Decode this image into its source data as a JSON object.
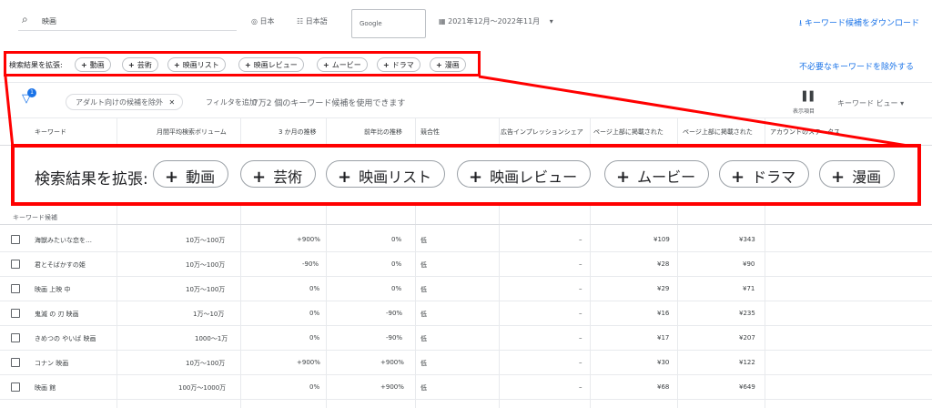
{
  "toolbar": {
    "search_text": "映画",
    "location": "日本",
    "language": "日本語",
    "engine": "Google",
    "date_range": "2021年12月～2022年11月",
    "download": "キーワード候補をダウンロード"
  },
  "refine": {
    "label": "検索結果を拡張:",
    "chips": [
      "動画",
      "芸術",
      "映画リスト",
      "映画レビュー",
      "ムービー",
      "ドラマ",
      "漫画"
    ],
    "exclude": "不必要なキーワードを除外する"
  },
  "filters": {
    "badge": "1",
    "adult_chip": "アダルト向けの候補を除外",
    "add_filter": "フィルタを追加",
    "count_text": "7万2 個のキーワード候補を使用できます",
    "columns_label": "表示項目",
    "keyword_view": "キーワード ビュー"
  },
  "table": {
    "headers": [
      "キーワード",
      "月間平均検索ボリューム",
      "3 か月の推移",
      "前年比の推移",
      "競合性",
      "広告インプレッションシェア",
      "ページ上部に掲載された",
      "ページ上部に掲載された",
      "アカウントのステータス"
    ],
    "section": "キーワード候補",
    "rows": [
      {
        "kw": "海獣みたいな恋を…",
        "vol": "10万～100万",
        "m3": "+900%",
        "yoy": "0%",
        "comp": "低",
        "share": "–",
        "low": "¥109",
        "high": "¥343"
      },
      {
        "kw": "君とそばかすの姫",
        "vol": "10万～100万",
        "m3": "-90%",
        "yoy": "0%",
        "comp": "低",
        "share": "–",
        "low": "¥28",
        "high": "¥90"
      },
      {
        "kw": "映画 上映 中",
        "vol": "10万～100万",
        "m3": "0%",
        "yoy": "0%",
        "comp": "低",
        "share": "–",
        "low": "¥29",
        "high": "¥71"
      },
      {
        "kw": "鬼滅 の 刃 映画",
        "vol": "1万～10万",
        "m3": "0%",
        "yoy": "-90%",
        "comp": "低",
        "share": "–",
        "low": "¥16",
        "high": "¥235"
      },
      {
        "kw": "きめつの やいば 映画",
        "vol": "1000～1万",
        "m3": "0%",
        "yoy": "-90%",
        "comp": "低",
        "share": "–",
        "low": "¥17",
        "high": "¥207"
      },
      {
        "kw": "コナン 映画",
        "vol": "10万～100万",
        "m3": "+900%",
        "yoy": "+900%",
        "comp": "低",
        "share": "–",
        "low": "¥30",
        "high": "¥122"
      },
      {
        "kw": "映画 館",
        "vol": "100万～1000万",
        "m3": "0%",
        "yoy": "+900%",
        "comp": "低",
        "share": "–",
        "low": "¥68",
        "high": "¥649"
      }
    ]
  },
  "colors": {
    "accent": "#1a73e8",
    "highlight": "#ff0000"
  }
}
